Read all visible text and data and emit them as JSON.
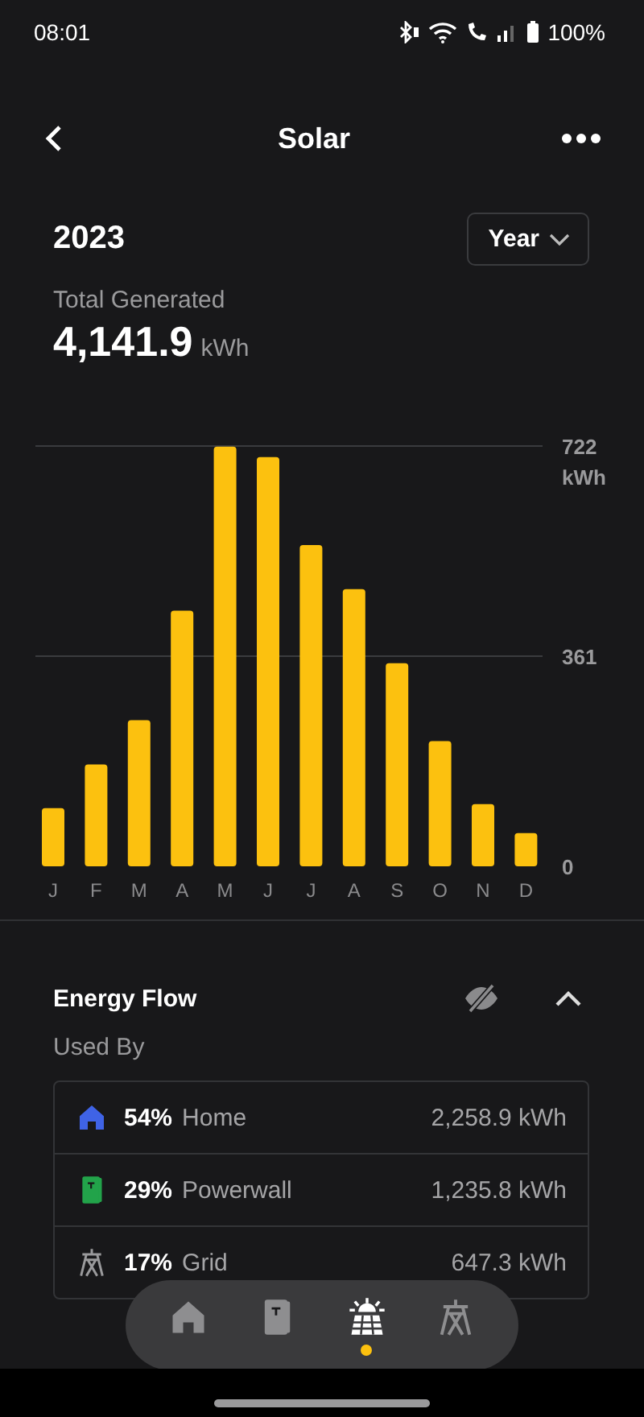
{
  "status_bar": {
    "time": "08:01",
    "battery": "100%"
  },
  "header": {
    "title": "Solar"
  },
  "summary": {
    "year": "2023",
    "period": "Year",
    "label": "Total Generated",
    "total": "4,141.9",
    "unit": "kWh"
  },
  "chart": {
    "chart_data": {
      "type": "bar",
      "categories": [
        "J",
        "F",
        "M",
        "A",
        "M",
        "J",
        "J",
        "A",
        "S",
        "O",
        "N",
        "D"
      ],
      "values": [
        100,
        175,
        251,
        439,
        721,
        703,
        552,
        476,
        349,
        215,
        107,
        57
      ],
      "ylim": [
        0,
        722
      ],
      "ylabel": "kWh",
      "yticks": [
        0,
        361,
        722
      ]
    }
  },
  "energy_flow": {
    "title": "Energy Flow",
    "expanded": true,
    "subtitle": "Used By",
    "rows": [
      {
        "kind": "home",
        "color": "#3f63e6",
        "percent": "54%",
        "label": "Home",
        "value": "2,258.9 kWh"
      },
      {
        "kind": "powerwall",
        "color": "#22a34a",
        "percent": "29%",
        "label": "Powerwall",
        "value": "1,235.8 kWh"
      },
      {
        "kind": "grid",
        "color": "#9a9a9c",
        "percent": "17%",
        "label": "Grid",
        "value": "647.3 kWh"
      }
    ]
  },
  "nav": [
    {
      "kind": "home",
      "selected": false
    },
    {
      "kind": "powerwall",
      "selected": false
    },
    {
      "kind": "solar",
      "selected": true
    },
    {
      "kind": "grid",
      "selected": false
    }
  ]
}
